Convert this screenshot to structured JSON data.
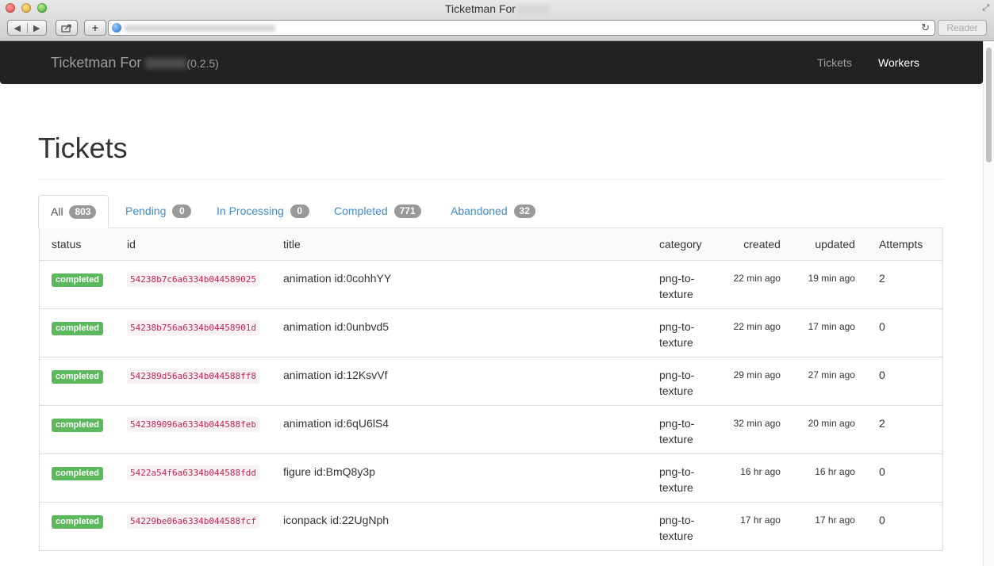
{
  "browser": {
    "window_title": "Ticketman For",
    "reader_label": "Reader"
  },
  "navbar": {
    "brand": "Ticketman For",
    "version": "(0.2.5)",
    "links": [
      {
        "label": "Tickets",
        "active": false
      },
      {
        "label": "Workers",
        "active": true
      }
    ]
  },
  "page": {
    "title": "Tickets"
  },
  "tabs": [
    {
      "label": "All",
      "count": "803",
      "active": true
    },
    {
      "label": "Pending",
      "count": "0",
      "active": false
    },
    {
      "label": "In Processing",
      "count": "0",
      "active": false
    },
    {
      "label": "Completed",
      "count": "771",
      "active": false
    },
    {
      "label": "Abandoned",
      "count": "32",
      "active": false
    }
  ],
  "table": {
    "columns": [
      "status",
      "id",
      "title",
      "category",
      "created",
      "updated",
      "Attempts"
    ],
    "rows": [
      {
        "status": "completed",
        "id": "54238b7c6a6334b044589025",
        "title": "animation id:0cohhYY",
        "category": "png-to-texture",
        "created": "22 min ago",
        "updated": "19 min ago",
        "attempts": "2"
      },
      {
        "status": "completed",
        "id": "54238b756a6334b04458901d",
        "title": "animation id:0unbvd5",
        "category": "png-to-texture",
        "created": "22 min ago",
        "updated": "17 min ago",
        "attempts": "0"
      },
      {
        "status": "completed",
        "id": "542389d56a6334b044588ff8",
        "title": "animation id:12KsvVf",
        "category": "png-to-texture",
        "created": "29 min ago",
        "updated": "27 min ago",
        "attempts": "0"
      },
      {
        "status": "completed",
        "id": "542389096a6334b044588feb",
        "title": "animation id:6qU6lS4",
        "category": "png-to-texture",
        "created": "32 min ago",
        "updated": "20 min ago",
        "attempts": "2"
      },
      {
        "status": "completed",
        "id": "5422a54f6a6334b044588fdd",
        "title": "figure id:BmQ8y3p",
        "category": "png-to-texture",
        "created": "16 hr ago",
        "updated": "16 hr ago",
        "attempts": "0"
      },
      {
        "status": "completed",
        "id": "54229be06a6334b044588fcf",
        "title": "iconpack id:22UgNph",
        "category": "png-to-texture",
        "created": "17 hr ago",
        "updated": "17 hr ago",
        "attempts": "0"
      }
    ]
  },
  "colors": {
    "navbar_bg": "#222222",
    "link": "#428bca",
    "status_completed": "#5cb85c",
    "code_text": "#c7254e"
  }
}
